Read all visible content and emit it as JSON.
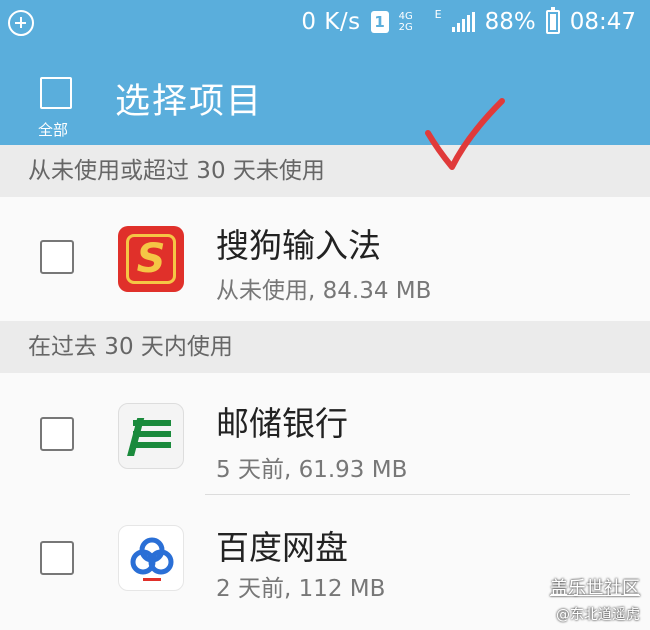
{
  "status_bar": {
    "speed": "0 K/s",
    "sim": "1",
    "net_top": "4G",
    "net_bottom": "2G",
    "edge": "E",
    "battery": "88%",
    "time": "08:47"
  },
  "app_bar": {
    "title": "选择项目",
    "select_all_label": "全部",
    "select_all_checked": false
  },
  "sections": [
    {
      "header": "从未使用或超过 30 天未使用",
      "items": [
        {
          "name": "搜狗输入法",
          "detail": "从未使用, 84.34 MB",
          "icon": "sogou-icon",
          "checked": false
        }
      ]
    },
    {
      "header": "在过去 30 天内使用",
      "items": [
        {
          "name": "邮储银行",
          "detail": "5 天前, 61.93 MB",
          "icon": "postal-bank-icon",
          "checked": false
        },
        {
          "name": "百度网盘",
          "detail": "2 天前, 112 MB",
          "icon": "baidu-netdisk-icon",
          "checked": false
        }
      ]
    }
  ],
  "annotation": {
    "mark": "checkmark",
    "color": "#e03a3a"
  },
  "watermark": {
    "line1": "盖乐世社区",
    "line2": "@东北道遥虎"
  },
  "colors": {
    "accent": "#5aaedc",
    "sogou_red": "#e0302a",
    "postal_green": "#1a8a3c",
    "baidu_blue": "#2a6fd6"
  }
}
